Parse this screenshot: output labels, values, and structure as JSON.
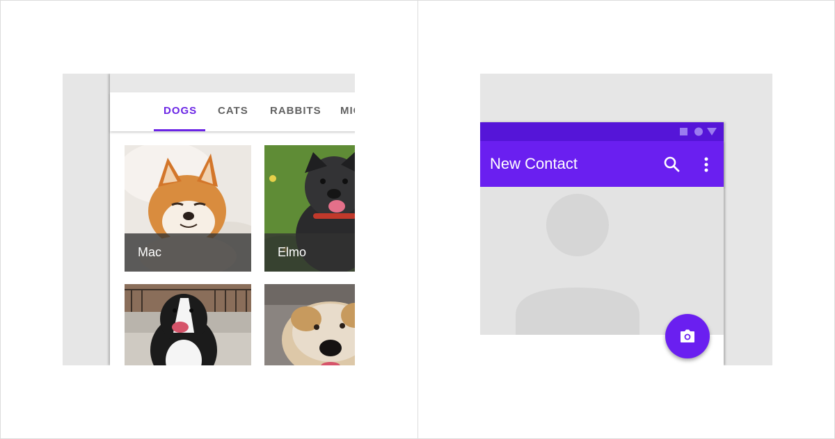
{
  "tabs": [
    {
      "label": "DOGS",
      "active": true
    },
    {
      "label": "CATS",
      "active": false
    },
    {
      "label": "RABBITS",
      "active": false
    },
    {
      "label": "MICE",
      "active": false
    }
  ],
  "photos": [
    {
      "caption": "Mac"
    },
    {
      "caption": "Elmo"
    },
    {
      "caption": ""
    },
    {
      "caption": ""
    }
  ],
  "contact": {
    "title": "New Contact"
  },
  "colors": {
    "accent": "#6a1ff0",
    "status_bar": "#5515d8",
    "tab_active": "#6a24e5",
    "tab_inactive": "#616161"
  },
  "icons": {
    "search": "search-icon",
    "overflow": "more-vert-icon",
    "fab": "camera-icon",
    "status": [
      "square-icon",
      "circle-icon",
      "triangle-icon"
    ]
  }
}
